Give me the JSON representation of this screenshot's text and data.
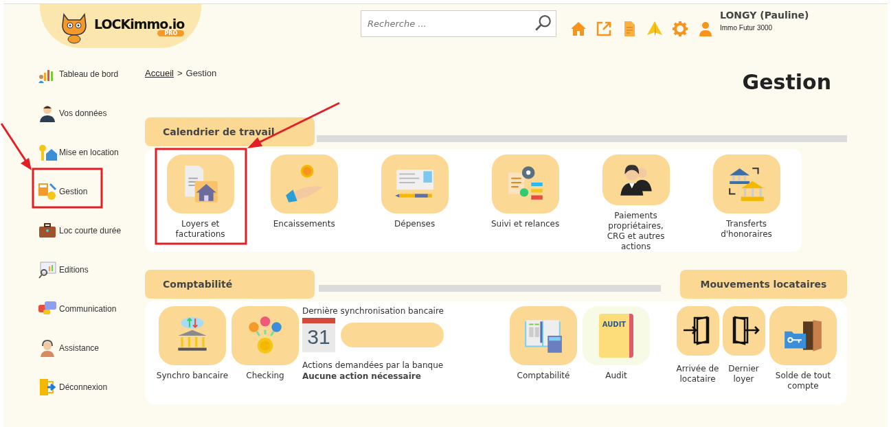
{
  "logo": {
    "name": "LOCKimmo.io",
    "badge": "PRO"
  },
  "search": {
    "placeholder": "Recherche ..."
  },
  "user": {
    "name": "LONGY (Pauline)",
    "company": "Immo Futur 3000"
  },
  "sidebar": {
    "items": [
      {
        "label": "Tableau de bord"
      },
      {
        "label": "Vos données"
      },
      {
        "label": "Mise en location"
      },
      {
        "label": "Gestion"
      },
      {
        "label": "Loc courte durée"
      },
      {
        "label": "Editions"
      },
      {
        "label": "Communication"
      },
      {
        "label": "Assistance"
      },
      {
        "label": "Déconnexion"
      }
    ]
  },
  "breadcrumb": {
    "home": "Accueil",
    "separator": ">",
    "current": "Gestion"
  },
  "page_title": "Gestion",
  "calendrier": {
    "title": "Calendrier de travail",
    "tiles": [
      {
        "label": "Loyers et facturations"
      },
      {
        "label": "Encaissements"
      },
      {
        "label": "Dépenses"
      },
      {
        "label": "Suivi et relances"
      },
      {
        "label": "Paiements propriétaires, CRG et autres actions"
      },
      {
        "label": "Transferts d'honoraires"
      }
    ]
  },
  "comptabilite": {
    "title": "Comptabilité",
    "tiles": [
      {
        "label": "Synchro bancaire"
      },
      {
        "label": "Checking"
      }
    ],
    "sync": {
      "label": "Dernière synchronisation bancaire",
      "calendar_day": "31",
      "actions_label": "Actions demandées par la banque",
      "actions_status": "Aucune action nécessaire"
    },
    "tiles_right": [
      {
        "label": "Comptabilité"
      },
      {
        "label": "Audit",
        "icon_text": "AUDIT"
      }
    ]
  },
  "mouvements": {
    "title": "Mouvements locataires",
    "tiles": [
      {
        "label": "Arrivée de locataire"
      },
      {
        "label": "Dernier loyer"
      },
      {
        "label": "Solde de tout compte"
      }
    ]
  }
}
